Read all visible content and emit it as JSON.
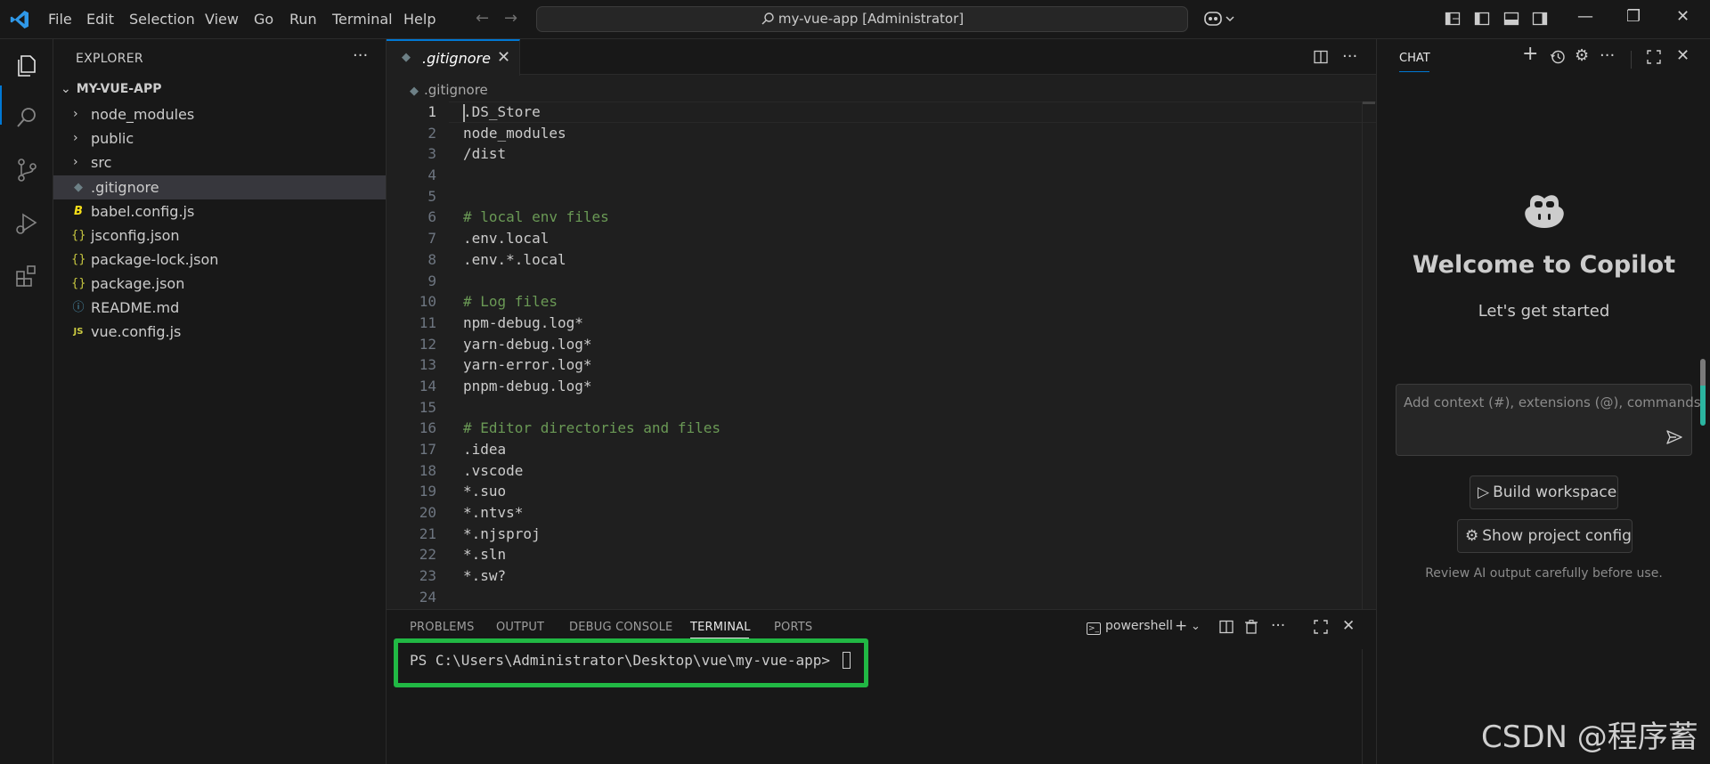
{
  "menu": [
    "File",
    "Edit",
    "Selection",
    "View",
    "Go",
    "Run",
    "Terminal",
    "Help"
  ],
  "window_title": "my-vue-app [Administrator]",
  "explorer": {
    "title": "EXPLORER",
    "project": "MY-VUE-APP",
    "items": [
      {
        "label": "node_modules",
        "type": "folder",
        "icon": "chevron-right-icon"
      },
      {
        "label": "public",
        "type": "folder",
        "icon": "chevron-right-icon"
      },
      {
        "label": "src",
        "type": "folder",
        "icon": "chevron-right-icon"
      },
      {
        "label": ".gitignore",
        "type": "file",
        "icon": "git-file-icon",
        "selected": true
      },
      {
        "label": "babel.config.js",
        "type": "file",
        "icon": "babel-file-icon"
      },
      {
        "label": "jsconfig.json",
        "type": "file",
        "icon": "json-file-icon"
      },
      {
        "label": "package-lock.json",
        "type": "file",
        "icon": "json-file-icon"
      },
      {
        "label": "package.json",
        "type": "file",
        "icon": "json-file-icon"
      },
      {
        "label": "README.md",
        "type": "file",
        "icon": "info-file-icon"
      },
      {
        "label": "vue.config.js",
        "type": "file",
        "icon": "js-file-icon"
      }
    ]
  },
  "editor": {
    "tab_label": ".gitignore",
    "breadcrumb": ".gitignore",
    "active_line": 1,
    "lines": [
      {
        "n": "1",
        "text": ".DS_Store",
        "comment": false
      },
      {
        "n": "2",
        "text": "node_modules",
        "comment": false
      },
      {
        "n": "3",
        "text": "/dist",
        "comment": false
      },
      {
        "n": "4",
        "text": "",
        "comment": false
      },
      {
        "n": "5",
        "text": "",
        "comment": false
      },
      {
        "n": "6",
        "text": "# local env files",
        "comment": true
      },
      {
        "n": "7",
        "text": ".env.local",
        "comment": false
      },
      {
        "n": "8",
        "text": ".env.*.local",
        "comment": false
      },
      {
        "n": "9",
        "text": "",
        "comment": false
      },
      {
        "n": "10",
        "text": "# Log files",
        "comment": true
      },
      {
        "n": "11",
        "text": "npm-debug.log*",
        "comment": false
      },
      {
        "n": "12",
        "text": "yarn-debug.log*",
        "comment": false
      },
      {
        "n": "13",
        "text": "yarn-error.log*",
        "comment": false
      },
      {
        "n": "14",
        "text": "pnpm-debug.log*",
        "comment": false
      },
      {
        "n": "15",
        "text": "",
        "comment": false
      },
      {
        "n": "16",
        "text": "# Editor directories and files",
        "comment": true
      },
      {
        "n": "17",
        "text": ".idea",
        "comment": false
      },
      {
        "n": "18",
        "text": ".vscode",
        "comment": false
      },
      {
        "n": "19",
        "text": "*.suo",
        "comment": false
      },
      {
        "n": "20",
        "text": "*.ntvs*",
        "comment": false
      },
      {
        "n": "21",
        "text": "*.njsproj",
        "comment": false
      },
      {
        "n": "22",
        "text": "*.sln",
        "comment": false
      },
      {
        "n": "23",
        "text": "*.sw?",
        "comment": false
      },
      {
        "n": "24",
        "text": "",
        "comment": false
      }
    ]
  },
  "panel": {
    "tabs": [
      "PROBLEMS",
      "OUTPUT",
      "DEBUG CONSOLE",
      "TERMINAL",
      "PORTS"
    ],
    "active_tab": "TERMINAL",
    "terminal_profile": "powershell",
    "prompt": "PS C:\\Users\\Administrator\\Desktop\\vue\\my-vue-app> ",
    "highlight_color": "#21b844"
  },
  "chat": {
    "tab": "CHAT",
    "welcome_title": "Welcome to Copilot",
    "welcome_subtitle": "Let's get started",
    "input_placeholder": "Add context (#), extensions (@), commands",
    "build_button": "Build workspace",
    "config_button": "Show project config",
    "review_note": "Review AI output carefully before use."
  },
  "watermark": "CSDN @程序蓄",
  "colors": {
    "accent": "#0078d4",
    "comment": "#6a9955",
    "highlight": "#21b844"
  }
}
